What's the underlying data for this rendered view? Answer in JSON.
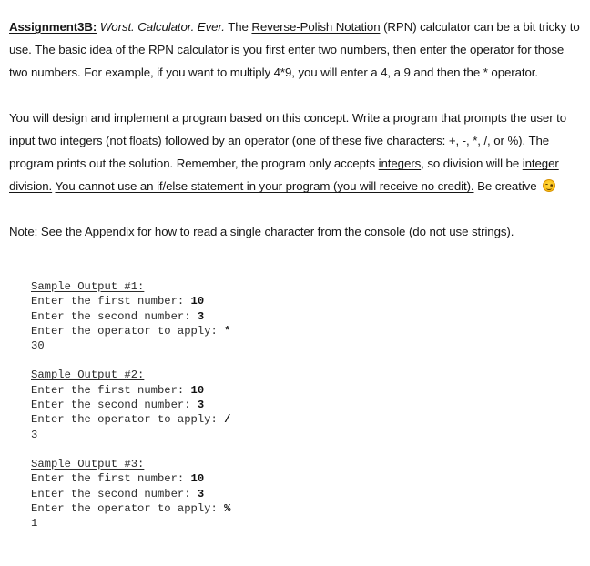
{
  "document": {
    "type": "assignment-handout",
    "intro": {
      "heading_label": "Assignment3B:",
      "subtitle_italic": "Worst. Calculator. Ever.",
      "text_before_rpn": " The ",
      "rpn_term": "Reverse-Polish Notation",
      "text_after_rpn": " (RPN) calculator can be a bit tricky to use. The basic idea of the RPN calculator is you first enter two numbers, then enter the operator for those two numbers. For example, if you want to multiply 4*9, you will enter a 4, a 9 and then the * operator."
    },
    "design": {
      "seg1": "You will design and implement a program based on this concept. Write a program that prompts the user to input two ",
      "seg2_underline": "integers (not floats)",
      "seg3": " followed by an operator (one of these five characters: +, -, *, /, or %). The program prints out the solution. Remember, the program only accepts ",
      "seg4_underline": "integers",
      "seg5": ", so division will be ",
      "seg6_underline": "integer division.",
      "seg7": " ",
      "seg8_underline": "You cannot use an if/else statement in your program (you will receive no credit).",
      "seg9": " Be creative ",
      "emoji_name": "smiling-face-emoji"
    },
    "note": {
      "text": "Note: See the Appendix for how to read a single character from the console (do not use strings)."
    },
    "samples": [
      {
        "title": "Sample Output #1:",
        "lines": [
          {
            "prompt": "Enter the first number: ",
            "input": "10"
          },
          {
            "prompt": "Enter the second number: ",
            "input": "3"
          },
          {
            "prompt": "Enter the operator to apply: ",
            "input": "*"
          },
          {
            "prompt": "30",
            "input": ""
          }
        ]
      },
      {
        "title": "Sample Output #2:",
        "lines": [
          {
            "prompt": "Enter the first number: ",
            "input": "10"
          },
          {
            "prompt": "Enter the second number: ",
            "input": "3"
          },
          {
            "prompt": "Enter the operator to apply: ",
            "input": "/"
          },
          {
            "prompt": "3",
            "input": ""
          }
        ]
      },
      {
        "title": "Sample Output #3:",
        "lines": [
          {
            "prompt": "Enter the first number: ",
            "input": "10"
          },
          {
            "prompt": "Enter the second number: ",
            "input": "3"
          },
          {
            "prompt": "Enter the operator to apply: ",
            "input": "%"
          },
          {
            "prompt": "1",
            "input": ""
          }
        ]
      }
    ]
  }
}
